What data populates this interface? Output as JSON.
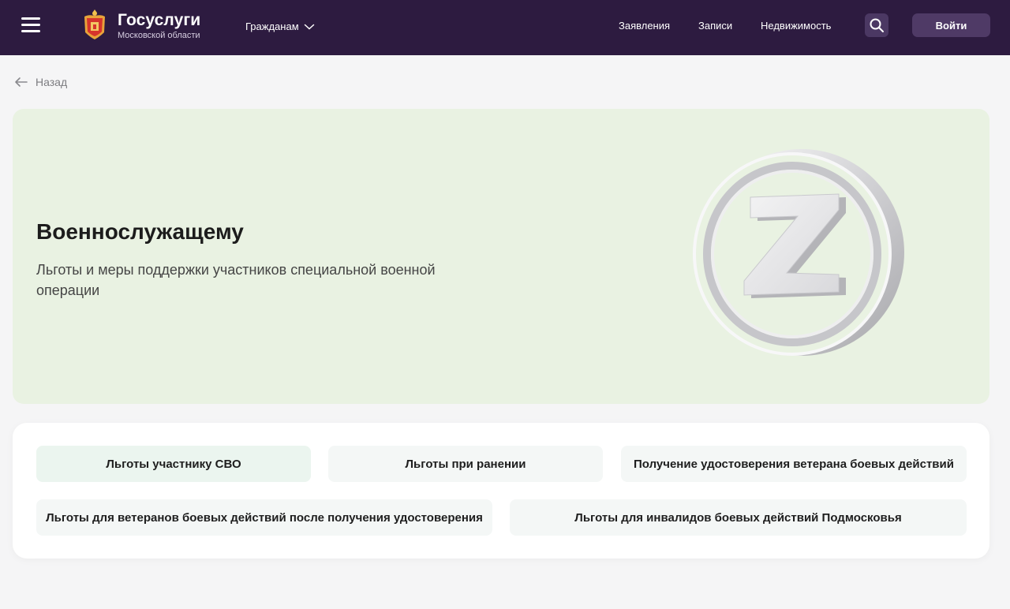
{
  "header": {
    "brand_title": "Госуслуги",
    "brand_subtitle": "Московской области",
    "citizens_label": "Гражданам",
    "nav": [
      "Заявления",
      "Записи",
      "Недвижимость"
    ],
    "login_label": "Войти",
    "background_color": "#2d1b40"
  },
  "back_label": "Назад",
  "hero": {
    "title": "Военнослужащему",
    "subtitle": "Льготы и меры поддержки участников специальной военной операции",
    "emblem_letter": "Z",
    "background_color": "#e9f2e2"
  },
  "links": [
    "Льготы участнику СВО",
    "Льготы при ранении",
    "Получение удостоверения ветерана боевых действий",
    "Льготы для ветеранов боевых действий после получения удостоверения",
    "Льготы для инвалидов боевых действий Подмосковья"
  ],
  "icons": [
    "menu-icon",
    "coat-of-arms-icon",
    "chevron-down-icon",
    "search-icon",
    "arrow-left-icon"
  ]
}
